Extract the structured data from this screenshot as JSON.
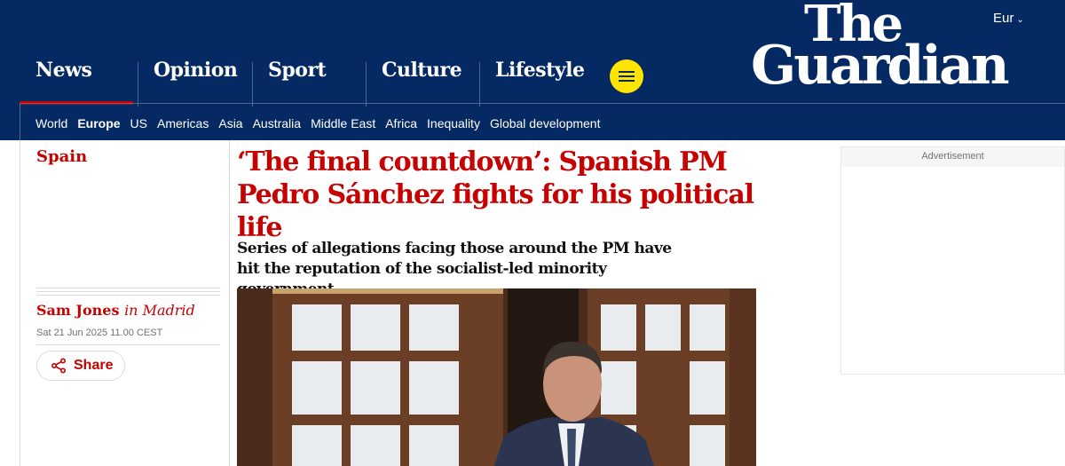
{
  "header": {
    "edition": "Eur",
    "logo_line1": "The",
    "logo_line2": "Guardian",
    "pillars": [
      {
        "label": "News"
      },
      {
        "label": "Opinion"
      },
      {
        "label": "Sport"
      },
      {
        "label": "Culture"
      },
      {
        "label": "Lifestyle"
      }
    ],
    "subnav": [
      "World",
      "Europe",
      "US",
      "Americas",
      "Asia",
      "Australia",
      "Middle East",
      "Africa",
      "Inequality",
      "Global development"
    ],
    "subnav_current": "Europe",
    "colors": {
      "background": "#052962",
      "accent": "#c70000",
      "menu_button": "#ffe500"
    }
  },
  "article": {
    "section": "Spain",
    "headline": "‘The final countdown’: Spanish PM Pedro Sánchez fights for his political life",
    "standfirst": "Series of allegations facing those around the PM have hit the reputation of the socialist-led minority government",
    "author": "Sam Jones",
    "location": "in Madrid",
    "date": "Sat 21 Jun 2025 11.00 CEST",
    "share_label": "Share"
  },
  "ad": {
    "label": "Advertisement"
  }
}
